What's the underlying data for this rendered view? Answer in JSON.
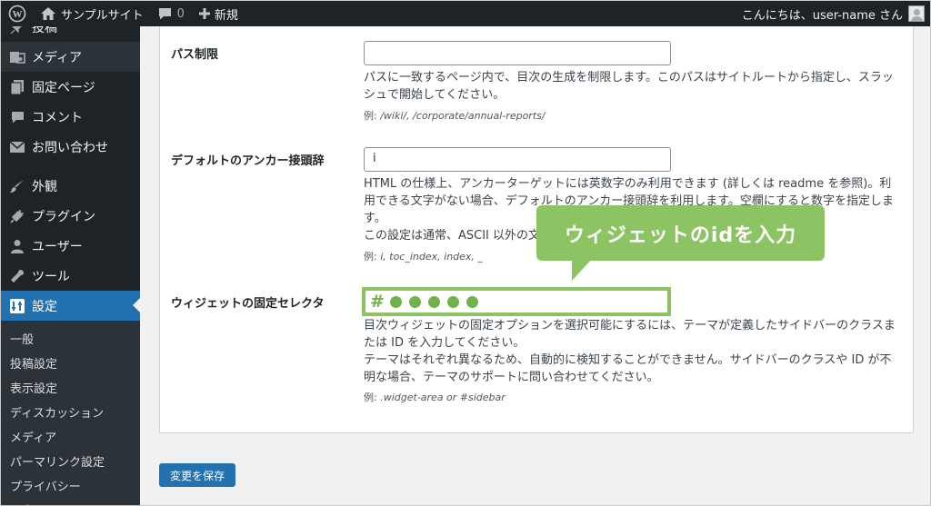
{
  "admin_bar": {
    "site_name": "サンプルサイト",
    "comments_count": "0",
    "new_label": "新規",
    "greeting": "こんにちは、user-name さん"
  },
  "sidebar": {
    "items": [
      {
        "label": "投稿",
        "icon": "pin-icon"
      },
      {
        "label": "メディア",
        "icon": "media-icon"
      },
      {
        "label": "固定ページ",
        "icon": "page-icon"
      },
      {
        "label": "コメント",
        "icon": "comment-icon"
      },
      {
        "label": "お問い合わせ",
        "icon": "mail-icon"
      },
      {
        "label": "外観",
        "icon": "brush-icon"
      },
      {
        "label": "プラグイン",
        "icon": "plugin-icon"
      },
      {
        "label": "ユーザー",
        "icon": "user-icon"
      },
      {
        "label": "ツール",
        "icon": "wrench-icon"
      },
      {
        "label": "設定",
        "icon": "settings-icon"
      }
    ],
    "submenu": [
      "一般",
      "投稿設定",
      "表示設定",
      "ディスカッション",
      "メディア",
      "パーマリンク設定",
      "プライバシー"
    ],
    "partial_bottom": "目次"
  },
  "settings": {
    "path_restriction": {
      "label": "パス制限",
      "value": "",
      "desc": "パスに一致するページ内で、目次の生成を制限します。このパスはサイトルートから指定し、スラッシュで開始してください。",
      "example_prefix": "例:",
      "example": "/wiki/, /corporate/annual-reports/"
    },
    "anchor_prefix": {
      "label": "デフォルトのアンカー接頭辞",
      "value": "i",
      "desc1": "HTML の仕様上、アンカーターゲットには英数字のみ利用できます (詳しくは readme を参照)。利用できる文字がない場合、デフォルトのアンカー接頭辞を利用します。空欄にすると数字を指定します。",
      "desc2": "この設定は通常、ASCII 以外の文",
      "example_prefix": "例:",
      "example": "i, toc_index, index, _"
    },
    "widget_selector": {
      "label": "ウィジェットの固定セレクタ",
      "hash": "#",
      "desc1": "目次ウィジェットの固定オプションを選択可能にするには、テーマが定義したサイドバーのクラスまたは ID を入力してください。",
      "desc2": "テーマはそれぞれ異なるため、自動的に検知することができません。サイドバーのクラスや ID が不明な場合、テーマのサポートに問い合わせてください。",
      "example_prefix": "例:",
      "example": ".widget-area or #sidebar"
    }
  },
  "callout": "ウィジェットのidを入力",
  "save_button": "変更を保存",
  "colors": {
    "admin_bg": "#1d2327",
    "accent": "#2271b1",
    "highlight_green": "#8cc463"
  }
}
